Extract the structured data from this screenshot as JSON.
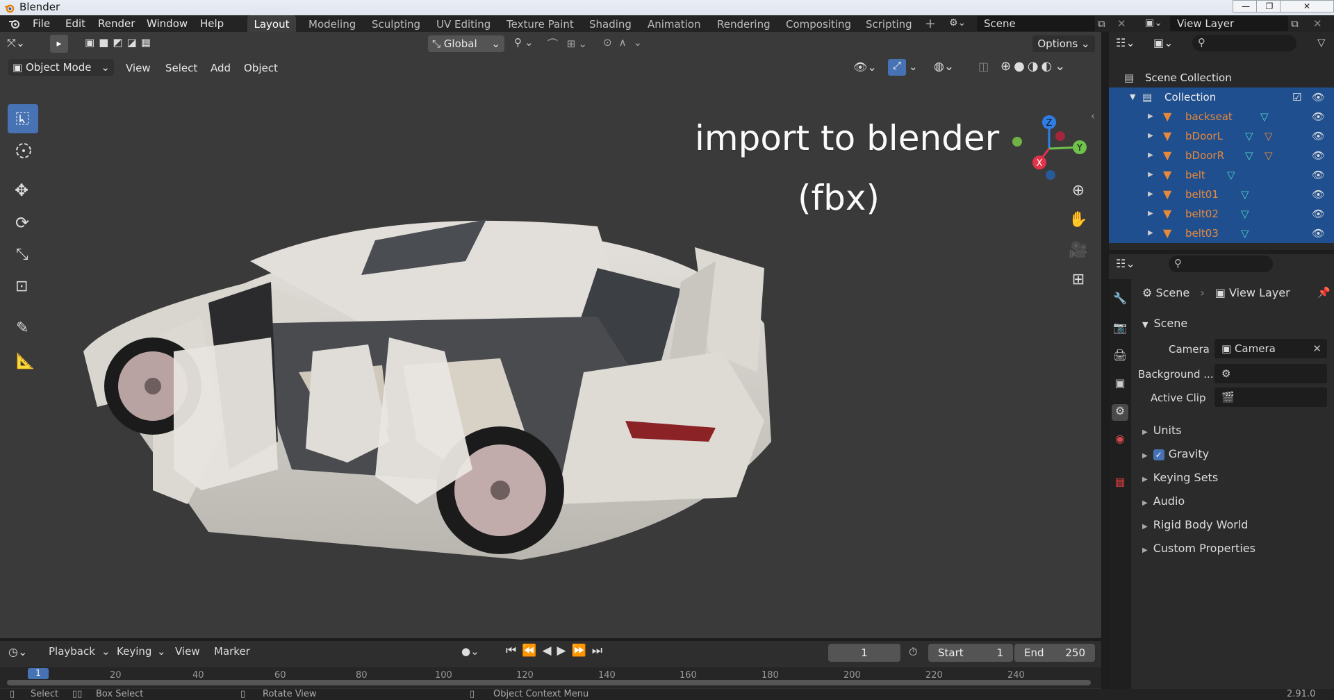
{
  "window": {
    "title": "Blender"
  },
  "menubar": {
    "items": [
      "File",
      "Edit",
      "Render",
      "Window",
      "Help"
    ]
  },
  "workspaces": [
    "Layout",
    "Modeling",
    "Sculpting",
    "UV Editing",
    "Texture Paint",
    "Shading",
    "Animation",
    "Rendering",
    "Compositing",
    "Scripting"
  ],
  "active_workspace": "Layout",
  "scene_selector": {
    "value": "Scene"
  },
  "view_layer_selector": {
    "value": "View Layer"
  },
  "viewport_toolbar": {
    "transform_orientation": "Global",
    "options": "Options"
  },
  "viewport_header": {
    "mode": "Object Mode",
    "menus": [
      "View",
      "Select",
      "Add",
      "Object"
    ]
  },
  "overlay_text": {
    "line1": "import to blender",
    "line2": "(fbx)"
  },
  "gizmo_axes": {
    "z": "Z",
    "y": "Y",
    "x": "X"
  },
  "outliner": {
    "scene_collection": "Scene Collection",
    "collection": "Collection",
    "objects": [
      "backseat",
      "bDoorL",
      "bDoorR",
      "belt",
      "belt01",
      "belt02",
      "belt03"
    ]
  },
  "properties": {
    "breadcrumb_scene": "Scene",
    "breadcrumb_view_layer": "View Layer",
    "panel_title": "Scene",
    "camera_label": "Camera",
    "camera_value": "Camera",
    "background_label": "Background ...",
    "active_clip_label": "Active Clip",
    "sections": [
      "Units",
      "Gravity",
      "Keying Sets",
      "Audio",
      "Rigid Body World",
      "Custom Properties"
    ],
    "gravity_checked": true
  },
  "timeline": {
    "menus": [
      "Playback",
      "Keying",
      "View",
      "Marker"
    ],
    "current_frame": "1",
    "start_label": "Start",
    "start_value": "1",
    "end_label": "End",
    "end_value": "250",
    "ruler_ticks": [
      "1",
      "20",
      "40",
      "60",
      "80",
      "100",
      "120",
      "140",
      "160",
      "180",
      "200",
      "220",
      "240"
    ]
  },
  "statusbar": {
    "select": "Select",
    "box_select": "Box Select",
    "rotate_view": "Rotate View",
    "context_menu": "Object Context Menu",
    "version": "2.91.0"
  },
  "colors": {
    "accent_blue": "#4772b3",
    "selection_row": "#1f4f8f",
    "object_orange": "#e8893a",
    "mesh_teal": "#4fd1c5"
  }
}
